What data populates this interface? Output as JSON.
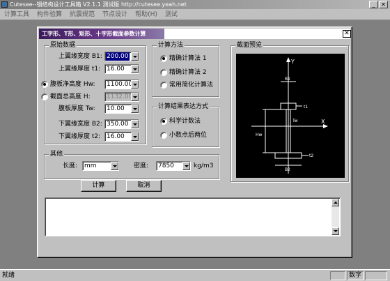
{
  "app": {
    "title": "Cutesee--钢结构设计工具箱 V2.1.1 测试版 http://cutesee.yeah.net"
  },
  "menubar": {
    "items": [
      "计算工具",
      "构件验算",
      "抗震规范",
      "节点设计",
      "帮助(H)",
      "测试"
    ]
  },
  "dialog": {
    "title": "工字形、T形、矩形、十字形截面参数计算",
    "close_label": "✕",
    "raw_data": {
      "group_title": "原始数据",
      "b1": {
        "label": "上翼缘宽度 B1:",
        "value": "200.00"
      },
      "t1": {
        "label": "上翼缘厚度 t1:",
        "value": "16.00"
      },
      "hw": {
        "label": "腹板净高度 Hw:",
        "value": "1100.00"
      },
      "h": {
        "label": "截面总高度 H:",
        "value": "1132.00"
      },
      "tw": {
        "label": "腹板厚度 Tw:",
        "value": "10.00"
      },
      "b2": {
        "label": "下翼缘宽度 B2:",
        "value": "350.00"
      },
      "t2": {
        "label": "下翼缘厚度 t2:",
        "value": "16.00"
      }
    },
    "calc_method": {
      "group_title": "计算方法",
      "options": [
        "精确计算法 1",
        "精确计算法 2",
        "常用简化计算法"
      ]
    },
    "result_format": {
      "group_title": "计算结果表达方式",
      "options": [
        "科学计数法",
        "小数点后两位"
      ]
    },
    "preview": {
      "group_title": "截面预览",
      "labels": {
        "y": "Y",
        "x": "X",
        "b1": "B1",
        "t1": "t1",
        "tw": "Tw",
        "hw": "Hw",
        "b2": "B2",
        "t2": "t2"
      }
    },
    "other": {
      "group_title": "其他",
      "length_label": "长度:",
      "length_value": "mm",
      "density_label": "密度:",
      "density_value": "7850",
      "density_unit": "kg/m3"
    },
    "buttons": {
      "calculate": "计算",
      "cancel": "取消"
    },
    "output_text": ""
  },
  "statusbar": {
    "ready": "就绪",
    "num": "数字"
  }
}
